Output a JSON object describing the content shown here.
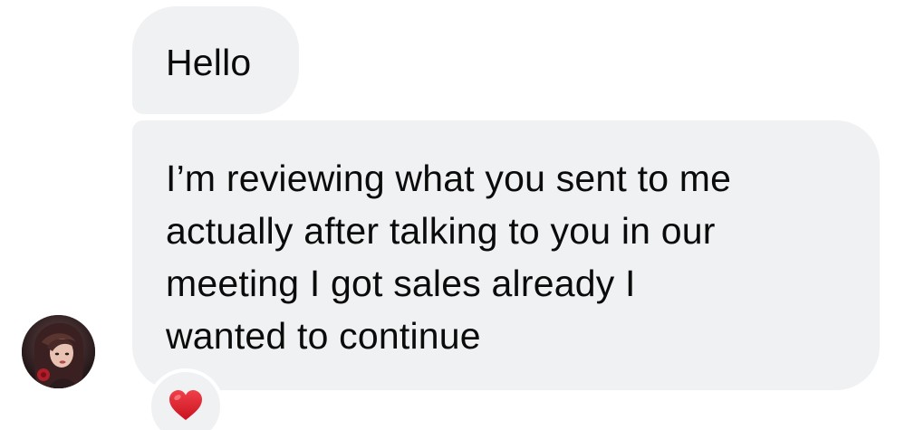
{
  "conversation": {
    "messages": [
      {
        "text": "Hello"
      },
      {
        "lines": [
          "I’m reviewing what you sent to me",
          "actually after talking to you in our",
          "meeting I got sales already I",
          "wanted to continue"
        ]
      }
    ],
    "reaction": {
      "icon": "red-heart-icon",
      "color": "#e0202c"
    },
    "bubble_color": "#f0f1f3"
  }
}
